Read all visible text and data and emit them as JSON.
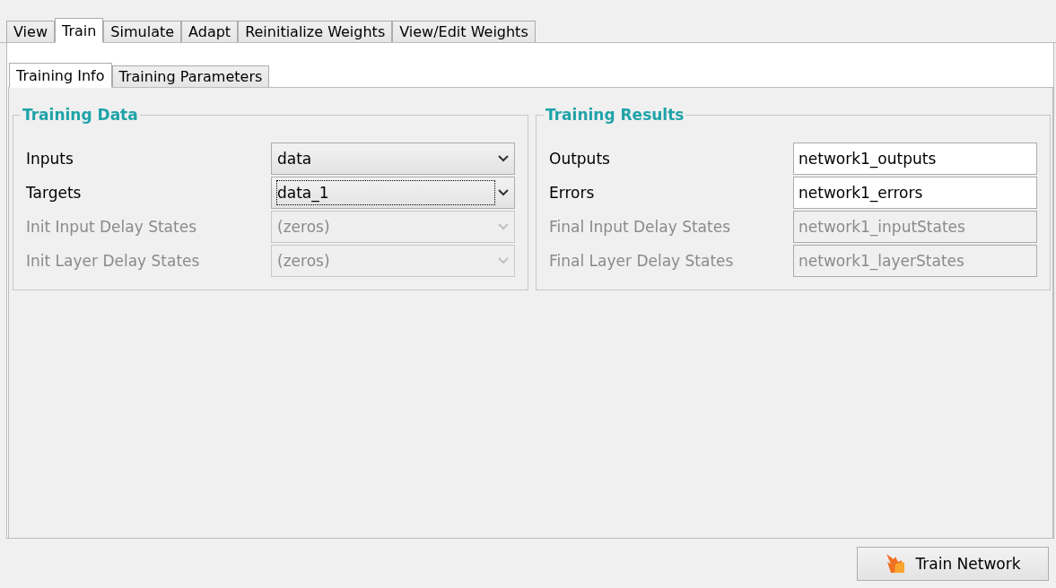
{
  "tabs": [
    {
      "label": "View",
      "selected": false
    },
    {
      "label": "Train",
      "selected": true
    },
    {
      "label": "Simulate",
      "selected": false
    },
    {
      "label": "Adapt",
      "selected": false
    },
    {
      "label": "Reinitialize Weights",
      "selected": false
    },
    {
      "label": "View/Edit Weights",
      "selected": false
    }
  ],
  "subtabs": [
    {
      "label": "Training Info",
      "selected": true
    },
    {
      "label": "Training Parameters",
      "selected": false
    }
  ],
  "training_data": {
    "title": "Training Data",
    "rows": [
      {
        "label": "Inputs",
        "value": "data",
        "disabled": false,
        "focused": false
      },
      {
        "label": "Targets",
        "value": "data_1",
        "disabled": false,
        "focused": true
      },
      {
        "label": "Init Input Delay States",
        "value": "(zeros)",
        "disabled": true,
        "focused": false
      },
      {
        "label": "Init Layer Delay States",
        "value": "(zeros)",
        "disabled": true,
        "focused": false
      }
    ]
  },
  "training_results": {
    "title": "Training Results",
    "rows": [
      {
        "label": "Outputs",
        "value": "network1_outputs",
        "disabled": false
      },
      {
        "label": "Errors",
        "value": "network1_errors",
        "disabled": false
      },
      {
        "label": "Final Input Delay States",
        "value": "network1_inputStates",
        "disabled": true
      },
      {
        "label": "Final Layer Delay States",
        "value": "network1_layerStates",
        "disabled": true
      }
    ]
  },
  "train_button": {
    "label": "Train Network"
  }
}
